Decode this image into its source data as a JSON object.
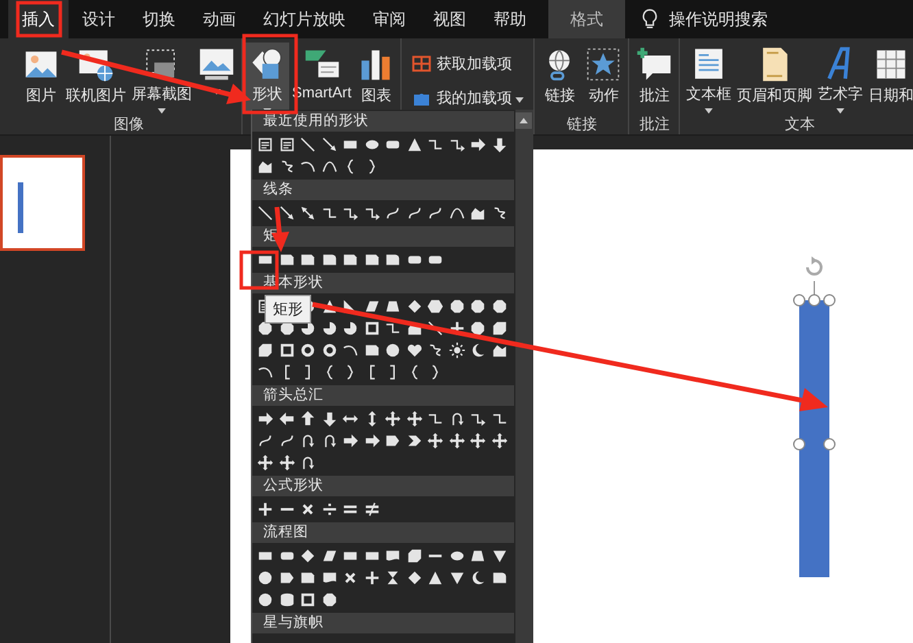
{
  "tabs": [
    {
      "label": "插入",
      "selected": true,
      "kind": "normal"
    },
    {
      "label": "设计",
      "selected": false,
      "kind": "normal"
    },
    {
      "label": "切换",
      "selected": false,
      "kind": "normal"
    },
    {
      "label": "动画",
      "selected": false,
      "kind": "normal"
    },
    {
      "label": "幻灯片放映",
      "selected": false,
      "kind": "normal"
    },
    {
      "label": "审阅",
      "selected": false,
      "kind": "normal"
    },
    {
      "label": "视图",
      "selected": false,
      "kind": "normal"
    },
    {
      "label": "帮助",
      "selected": false,
      "kind": "normal"
    },
    {
      "label": "格式",
      "selected": false,
      "kind": "contextual"
    }
  ],
  "search": {
    "label": "操作说明搜索"
  },
  "ribbon": [
    {
      "label": "图像",
      "buttons": [
        {
          "kind": "large",
          "label": "图片",
          "dropdown": false,
          "pressed": false
        },
        {
          "kind": "large",
          "label": "联机图片",
          "dropdown": false,
          "pressed": false
        },
        {
          "kind": "large",
          "label": "屏幕截图",
          "dropdown": true,
          "pressed": false
        },
        {
          "kind": "large",
          "dropdown": true,
          "pressed": false
        }
      ]
    },
    {
      "buttons": [
        {
          "kind": "large",
          "label": "形状",
          "dropdown": true,
          "pressed": true
        },
        {
          "kind": "large",
          "label": "SmartArt",
          "dropdown": false,
          "pressed": false
        },
        {
          "kind": "large",
          "label": "图表",
          "dropdown": false,
          "pressed": false
        }
      ]
    },
    {
      "buttons": [
        {
          "kind": "small",
          "label": "获取加载项",
          "dropdown": false,
          "pressed": false
        },
        {
          "kind": "small",
          "label": "我的加载项",
          "dropdown": true,
          "pressed": false
        }
      ]
    },
    {
      "label": "链接",
      "buttons": [
        {
          "kind": "large",
          "label": "链接",
          "dropdown": false,
          "pressed": false
        },
        {
          "kind": "large",
          "label": "动作",
          "dropdown": false,
          "pressed": false
        }
      ]
    },
    {
      "label": "批注",
      "buttons": [
        {
          "kind": "large",
          "label": "批注",
          "dropdown": false,
          "pressed": false
        }
      ]
    },
    {
      "label": "文本",
      "buttons": [
        {
          "kind": "large",
          "label": "文本框",
          "dropdown": true,
          "pressed": false
        },
        {
          "kind": "large",
          "label": "页眉和页脚",
          "dropdown": false,
          "pressed": false
        },
        {
          "kind": "large",
          "label": "艺术字",
          "dropdown": true,
          "pressed": false
        },
        {
          "kind": "large",
          "label": "日期和",
          "dropdown": false,
          "pressed": false
        }
      ]
    }
  ],
  "thumbnails": [
    {
      "selected": true
    }
  ],
  "slide": {
    "shape": {
      "kind": "rectangle",
      "selected": true
    }
  },
  "shapes_menu": {
    "sections": [
      {
        "title": "最近使用的形状"
      },
      {
        "title": "线条"
      },
      {
        "title": "矩"
      },
      {
        "title": "基本形状"
      },
      {
        "title": "箭头总汇"
      },
      {
        "title": "公式形状"
      },
      {
        "title": "流程图"
      },
      {
        "title": "星与旗帜"
      }
    ]
  },
  "tooltip": {
    "text": "矩形"
  }
}
